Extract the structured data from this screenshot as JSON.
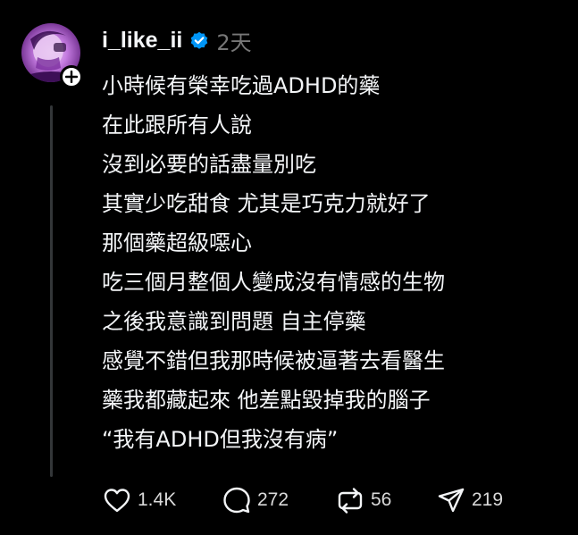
{
  "post": {
    "username": "i_like_ii",
    "time": "2天",
    "lines": [
      "小時候有榮幸吃過ADHD的藥",
      "在此跟所有人說",
      "沒到必要的話盡量別吃",
      "其實少吃甜食 尤其是巧克力就好了",
      "那個藥超級噁心",
      "吃三個月整個人變成沒有情感的生物",
      "之後我意識到問題 自主停藥",
      "感覺不錯但我那時候被逼著去看醫生",
      "藥我都藏起來 他差點毀掉我的腦子",
      "“我有ADHD但我沒有病”"
    ]
  },
  "actions": {
    "like_count": "1.4K",
    "comment_count": "272",
    "repost_count": "56",
    "share_count": "219"
  },
  "icons": {
    "follow": "plus-icon",
    "verified": "verified-badge-icon",
    "like": "heart-icon",
    "comment": "comment-bubble-icon",
    "repost": "repost-arrows-icon",
    "share": "send-plane-icon"
  },
  "colors": {
    "background": "#000000",
    "text": "#f3f5f7",
    "muted": "#777777",
    "verified": "#0095f6",
    "thread_line": "#333638"
  }
}
